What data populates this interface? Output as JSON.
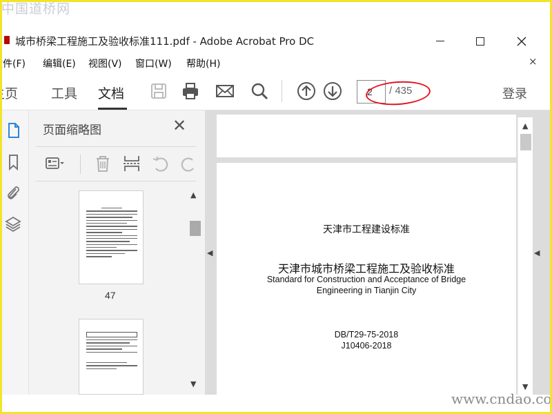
{
  "watermarks": {
    "top": "中国道桥网",
    "bottom": "www.cndao.com"
  },
  "window": {
    "title": "城市桥梁工程施工及验收标准111.pdf - Adobe Acrobat Pro DC"
  },
  "menu": {
    "items": [
      "文件(F)",
      "编辑(E)",
      "视图(V)",
      "窗口(W)",
      "帮助(H)"
    ],
    "close_glyph": "×"
  },
  "toolbar": {
    "tabs": [
      "主页",
      "工具",
      "文档"
    ],
    "active_tab": "文档",
    "icons": [
      "save-icon",
      "print-icon",
      "mail-icon",
      "search-icon",
      "prev-page-icon",
      "next-page-icon"
    ],
    "page_current": "2",
    "page_total": "/ 435",
    "login_label": "登录"
  },
  "rail": {
    "icons": [
      "page-thumbnails-icon",
      "bookmark-icon",
      "attachment-icon",
      "layers-icon"
    ]
  },
  "thumbnail_panel": {
    "title": "页面缩略图",
    "close_glyph": "✕",
    "tools": [
      "options-icon",
      "delete-icon",
      "insert-icon",
      "rotate-left-icon",
      "rotate-right-icon"
    ],
    "thumbnails": [
      {
        "page_label": "47"
      },
      {
        "page_label": ""
      }
    ]
  },
  "document": {
    "city_standard": "天津市工程建设标准",
    "title_cn": "天津市城市桥梁工程施工及验收标准",
    "title_en_line1": "Standard for Construction and Acceptance of Bridge",
    "title_en_line2": "Engineering in Tianjin City",
    "code1": "DB/T29-75-2018",
    "code2": "J10406-2018"
  },
  "colors": {
    "annotation": "#e0141e",
    "frame": "#f2e42a",
    "app_icon": "#b30b00"
  }
}
